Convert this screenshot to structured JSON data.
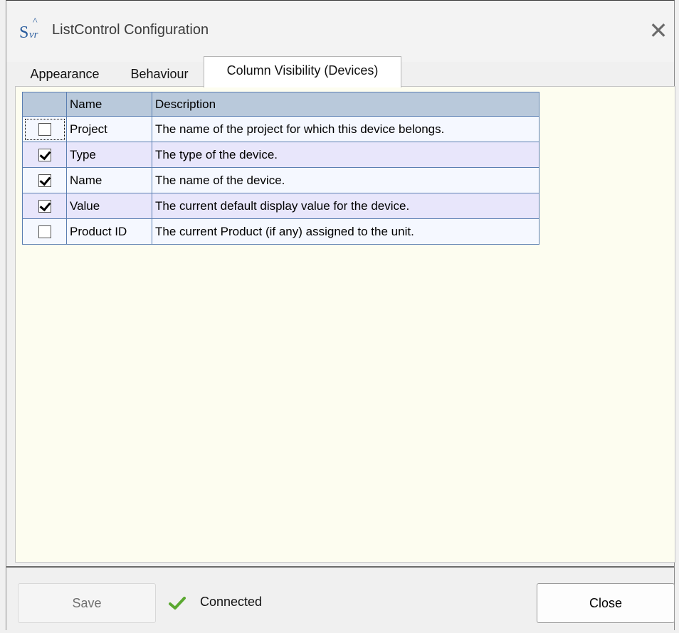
{
  "window": {
    "title": "ListControl Configuration",
    "icon": "svr-app-icon",
    "icon_text_s": "S",
    "icon_text_vr": "vr",
    "icon_text_caret": "^",
    "close_glyph": "✕"
  },
  "tabs": [
    {
      "label": "Appearance",
      "active": false
    },
    {
      "label": "Behaviour",
      "active": false
    },
    {
      "label": "Column Visibility (Devices)",
      "active": true
    }
  ],
  "grid": {
    "headers": [
      "",
      "Name",
      "Description"
    ],
    "rows": [
      {
        "checked": false,
        "name": "Project",
        "description": "The name of the project for which this device belongs."
      },
      {
        "checked": true,
        "name": "Type",
        "description": "The type of the device."
      },
      {
        "checked": true,
        "name": "Name",
        "description": "The name of the device."
      },
      {
        "checked": true,
        "name": "Value",
        "description": "The current default display value for the device."
      },
      {
        "checked": false,
        "name": "Product ID",
        "description": "The current Product (if any) assigned to the unit."
      }
    ]
  },
  "footer": {
    "save_label": "Save",
    "save_enabled": false,
    "status_icon": "green-check-icon",
    "status_text": "Connected",
    "close_label": "Close"
  },
  "colors": {
    "content_background": "#fdfdf0",
    "header_background": "#b9c9db",
    "row_odd": "#f5f8ff",
    "row_even": "#e8e6fb",
    "grid_border": "#5b7fb2",
    "status_check": "#5aa830"
  }
}
